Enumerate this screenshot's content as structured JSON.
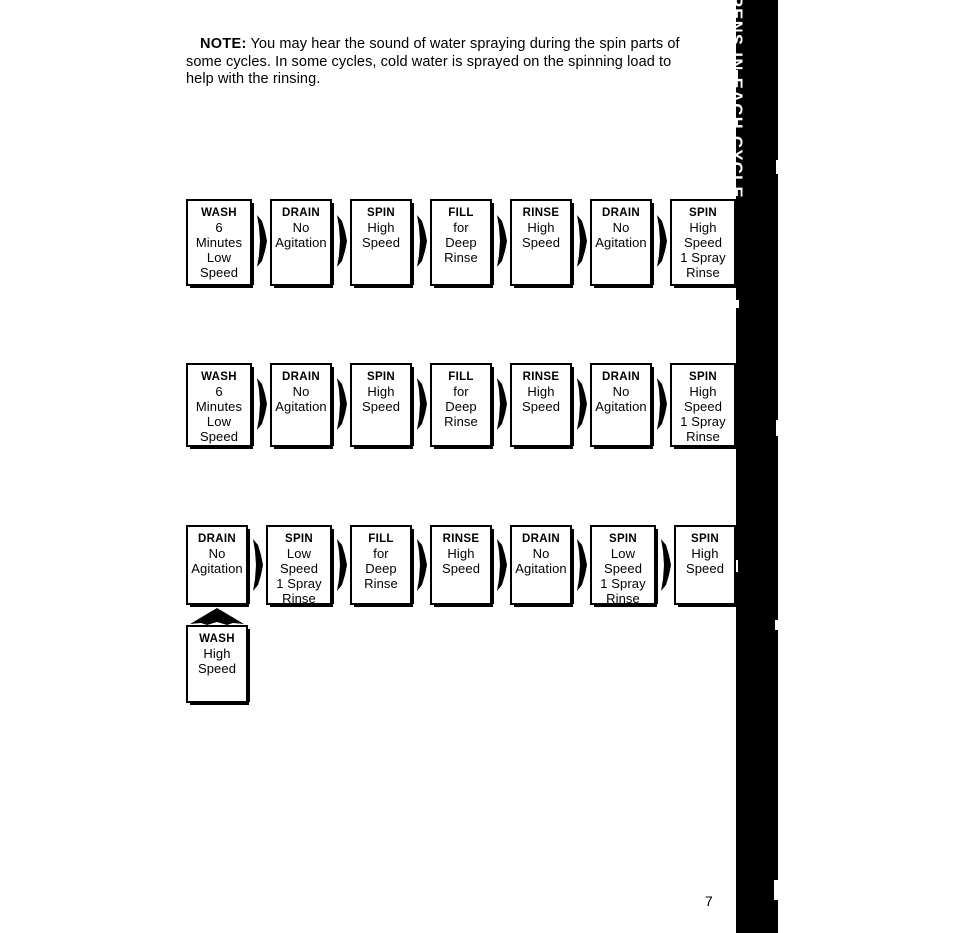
{
  "note": {
    "label": "NOTE:",
    "text": " You may hear the sound of water spraying during the spin parts of some cycles. In some cycles, cold water is sprayed on the spinning load to help with the rinsing."
  },
  "side_tab": {
    "label": "WHAT HAPPENS IN EACH CYCLE",
    "background": "#000000",
    "text_color": "#ffffff"
  },
  "page_number": "7",
  "icons": {
    "connector": "right-arrow-icon",
    "up_connector": "up-arrow-icon"
  },
  "chart_data": {
    "type": "diagram",
    "title": "What Happens In Each Cycle",
    "diagram_kind": "flowchart",
    "rows": [
      {
        "id": "cycle-row-1",
        "steps": [
          {
            "title": "WASH",
            "lines": [
              "6",
              "Minutes",
              "Low",
              "Speed"
            ]
          },
          {
            "title": "DRAIN",
            "lines": [
              "No",
              "Agitation"
            ]
          },
          {
            "title": "SPIN",
            "lines": [
              "High",
              "Speed"
            ]
          },
          {
            "title": "FILL",
            "lines": [
              "for",
              "Deep",
              "Rinse"
            ]
          },
          {
            "title": "RINSE",
            "lines": [
              "High",
              "Speed"
            ]
          },
          {
            "title": "DRAIN",
            "lines": [
              "No",
              "Agitation"
            ]
          },
          {
            "title": "SPIN",
            "lines": [
              "High",
              "Speed",
              "1 Spray",
              "Rinse"
            ]
          }
        ]
      },
      {
        "id": "cycle-row-2",
        "steps": [
          {
            "title": "WASH",
            "lines": [
              "6",
              "Minutes",
              "Low",
              "Speed"
            ]
          },
          {
            "title": "DRAIN",
            "lines": [
              "No",
              "Agitation"
            ]
          },
          {
            "title": "SPIN",
            "lines": [
              "High",
              "Speed"
            ]
          },
          {
            "title": "FILL",
            "lines": [
              "for",
              "Deep",
              "Rinse"
            ]
          },
          {
            "title": "RINSE",
            "lines": [
              "High",
              "Speed"
            ]
          },
          {
            "title": "DRAIN",
            "lines": [
              "No",
              "Agitation"
            ]
          },
          {
            "title": "SPIN",
            "lines": [
              "High",
              "Speed",
              "1 Spray",
              "Rinse"
            ]
          }
        ]
      },
      {
        "id": "cycle-row-3",
        "steps": [
          {
            "title": "DRAIN",
            "lines": [
              "No",
              "Agitation"
            ]
          },
          {
            "title": "SPIN",
            "lines": [
              "Low",
              "Speed",
              "1 Spray",
              "Rinse"
            ]
          },
          {
            "title": "FILL",
            "lines": [
              "for",
              "Deep",
              "Rinse"
            ]
          },
          {
            "title": "RINSE",
            "lines": [
              "High",
              "Speed"
            ]
          },
          {
            "title": "DRAIN",
            "lines": [
              "No",
              "Agitation"
            ]
          },
          {
            "title": "SPIN",
            "lines": [
              "Low",
              "Speed",
              "1 Spray",
              "Rinse"
            ]
          },
          {
            "title": "SPIN",
            "lines": [
              "High",
              "Speed"
            ]
          }
        ],
        "entry_step": {
          "title": "WASH",
          "lines": [
            "High",
            "Speed"
          ]
        }
      }
    ]
  }
}
